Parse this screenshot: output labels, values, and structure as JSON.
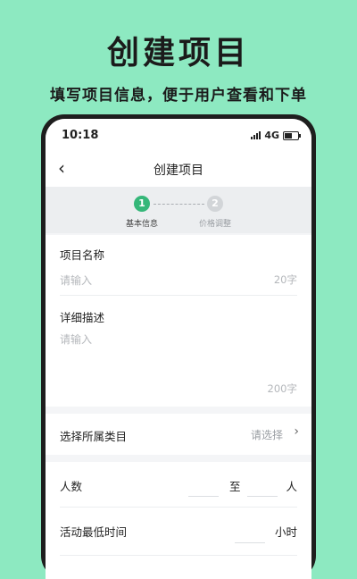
{
  "promo": {
    "title": "创建项目",
    "subtitle": "填写项目信息，便于用户查看和下单"
  },
  "status_bar": {
    "time": "10:18",
    "network": "4G"
  },
  "nav": {
    "title": "创建项目"
  },
  "steps": [
    {
      "number": "1",
      "label": "基本信息",
      "active": true
    },
    {
      "number": "2",
      "label": "价格调整",
      "active": false
    }
  ],
  "form": {
    "project_name": {
      "label": "项目名称",
      "placeholder": "请输入",
      "counter": "20字"
    },
    "description": {
      "label": "详细描述",
      "placeholder": "请输入",
      "counter": "200字"
    },
    "category": {
      "label": "选择所属类目",
      "value": "请选择"
    },
    "people": {
      "label": "人数",
      "separator": "至",
      "unit": "人"
    },
    "min_time": {
      "label": "活动最低时间",
      "unit": "小时"
    }
  },
  "colors": {
    "background": "#8de9c1",
    "accent": "#35b779",
    "inactive_step": "#d2d5d8"
  }
}
